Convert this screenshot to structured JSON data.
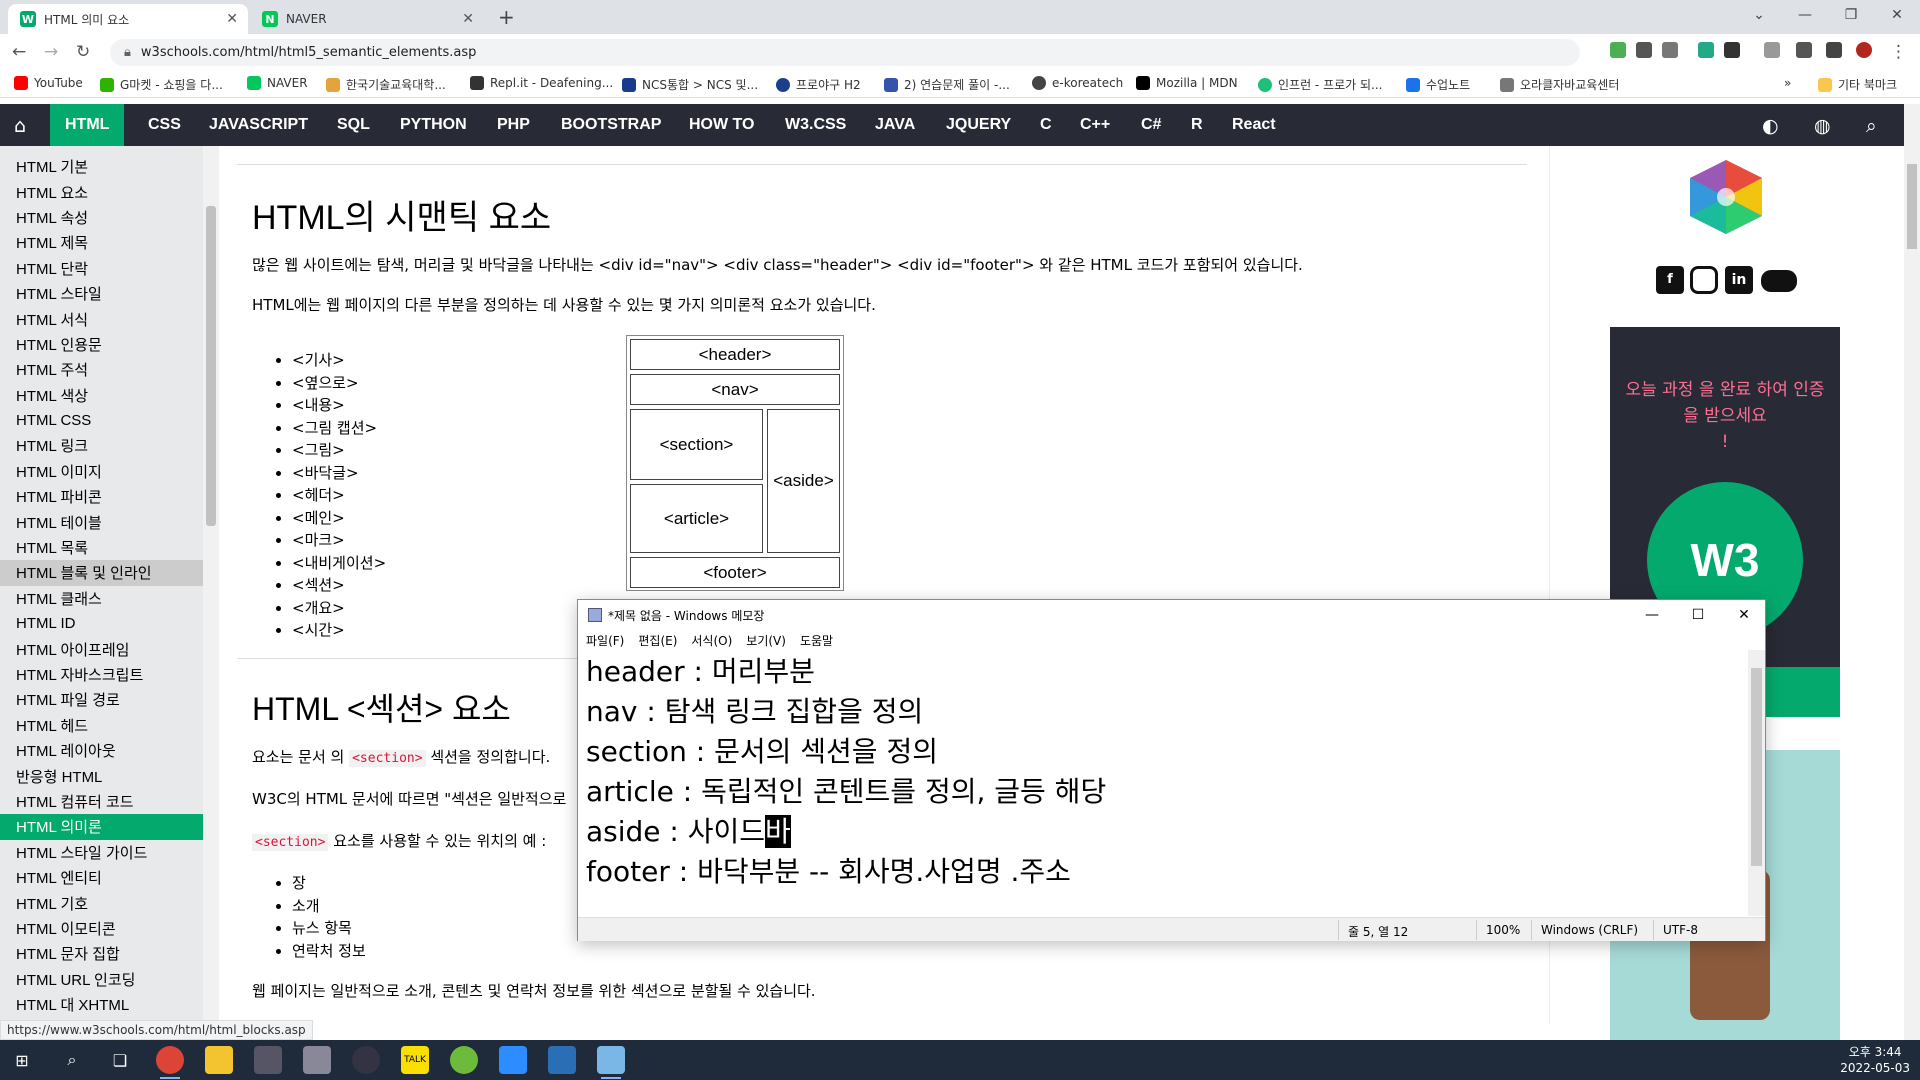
{
  "browser": {
    "tabs": [
      {
        "title": "HTML 의미 요소",
        "favicon": "w3schools-icon",
        "active": true
      },
      {
        "title": "NAVER",
        "favicon": "naver-icon",
        "active": false
      }
    ],
    "url": "w3schools.com/html/html5_semantic_elements.asp",
    "bookmarks": [
      "YouTube",
      "G마켓 - 쇼핑을 다...",
      "NAVER",
      "한국기술교육대학...",
      "Repl.it - Deafening...",
      "NCS통합 > NCS 및...",
      "프로야구 H2",
      "2) 연습문제 풀이 -...",
      "e-koreatech",
      "Mozilla | MDN",
      "인프런 - 프로가 되...",
      "수업노트",
      "오라클자바교육센터"
    ],
    "other_bookmarks": "기타 북마크",
    "status_url": "https://www.w3schools.com/html/html_blocks.asp"
  },
  "topnav": {
    "items": [
      "HTML",
      "CSS",
      "JAVASCRIPT",
      "SQL",
      "PYTHON",
      "PHP",
      "BOOTSTRAP",
      "HOW TO",
      "W3.CSS",
      "JAVA",
      "JQUERY",
      "C",
      "C++",
      "C#",
      "R",
      "React"
    ],
    "active": "HTML"
  },
  "sidebar": {
    "items": [
      "HTML 기본",
      "HTML 요소",
      "HTML 속성",
      "HTML 제목",
      "HTML 단락",
      "HTML 스타일",
      "HTML 서식",
      "HTML 인용문",
      "HTML 주석",
      "HTML 색상",
      "HTML CSS",
      "HTML 링크",
      "HTML 이미지",
      "HTML 파비콘",
      "HTML 테이블",
      "HTML 목록",
      "HTML 블록 및 인라인",
      "HTML 클래스",
      "HTML ID",
      "HTML 아이프레임",
      "HTML 자바스크립트",
      "HTML 파일 경로",
      "HTML 헤드",
      "HTML 레이아웃",
      "반응형 HTML",
      "HTML 컴퓨터 코드",
      "HTML 의미론",
      "HTML 스타일 가이드",
      "HTML 엔티티",
      "HTML 기호",
      "HTML 이모티콘",
      "HTML 문자 집합",
      "HTML URL 인코딩",
      "HTML 대 XHTML"
    ],
    "hover": "HTML 블록 및 인라인",
    "active": "HTML 의미론"
  },
  "main": {
    "h1": "HTML의 시맨틱 요소",
    "p1": "많은 웹 사이트에는 탐색, 머리글 및 바닥글을 나타내는 <div id=\"nav\"> <div class=\"header\"> <div id=\"footer\"> 와 같은 HTML 코드가 포함되어 있습니다.",
    "p2": "HTML에는 웹 페이지의 다른 부분을 정의하는 데 사용할 수 있는 몇 가지 의미론적 요소가 있습니다.",
    "elements": [
      "<기사>",
      "<옆으로>",
      "<내용>",
      "<그림 캡션>",
      "<그림>",
      "<바닥글>",
      "<헤더>",
      "<메인>",
      "<마크>",
      "<내비게이션>",
      "<섹션>",
      "<개요>",
      "<시간>"
    ],
    "diagram": {
      "header": "<header>",
      "nav": "<nav>",
      "section": "<section>",
      "article": "<article>",
      "aside": "<aside>",
      "footer": "<footer>"
    },
    "h2": "HTML <섹션> 요소",
    "p3_pre": "요소는 문서 의 ",
    "p3_code": "<section>",
    "p3_post": " 섹션을 정의합니다.",
    "p4": "W3C의 HTML 문서에 따르면 \"섹션은 일반적으로",
    "p5_code": "<section>",
    "p5_post": " 요소를 사용할 수 있는 위치의 예 :",
    "section_uses": [
      "장",
      "소개",
      "뉴스 항목",
      "연락처 정보"
    ],
    "p6": "웹 페이지는 일반적으로 소개, 콘텐츠 및 연락처 정보를 위한 섹션으로 분할될 수 있습니다."
  },
  "ad": {
    "line1": "오늘 과정 을 완료 하여 인증",
    "line2": "을 받으세요",
    "line3": "!",
    "badge": "W3"
  },
  "notepad": {
    "title": "*제목 없음 - Windows 메모장",
    "menu": [
      "파일(F)",
      "편집(E)",
      "서식(O)",
      "보기(V)",
      "도움말"
    ],
    "lines": [
      "header : 머리부분",
      "nav : 탐색 링크 집합을 정의",
      "section : 문서의 섹션을 정의",
      "article : 독립적인 콘텐트를 정의, 글등 해당",
      "aside : 사이드",
      "footer : 바닥부분 -- 회사명.사업명 .주소"
    ],
    "selected_text": "바",
    "status": {
      "position": "줄 5, 열 12",
      "zoom": "100%",
      "eol": "Windows (CRLF)",
      "encoding": "UTF-8"
    }
  },
  "taskbar": {
    "time": "오후 3:44",
    "date": "2022-05-03"
  },
  "colors": {
    "w3_green": "#04aa6d",
    "nav_dark": "#282a35",
    "sidebar_bg": "#e7e9eb",
    "ad_pink": "#ff6f91"
  }
}
